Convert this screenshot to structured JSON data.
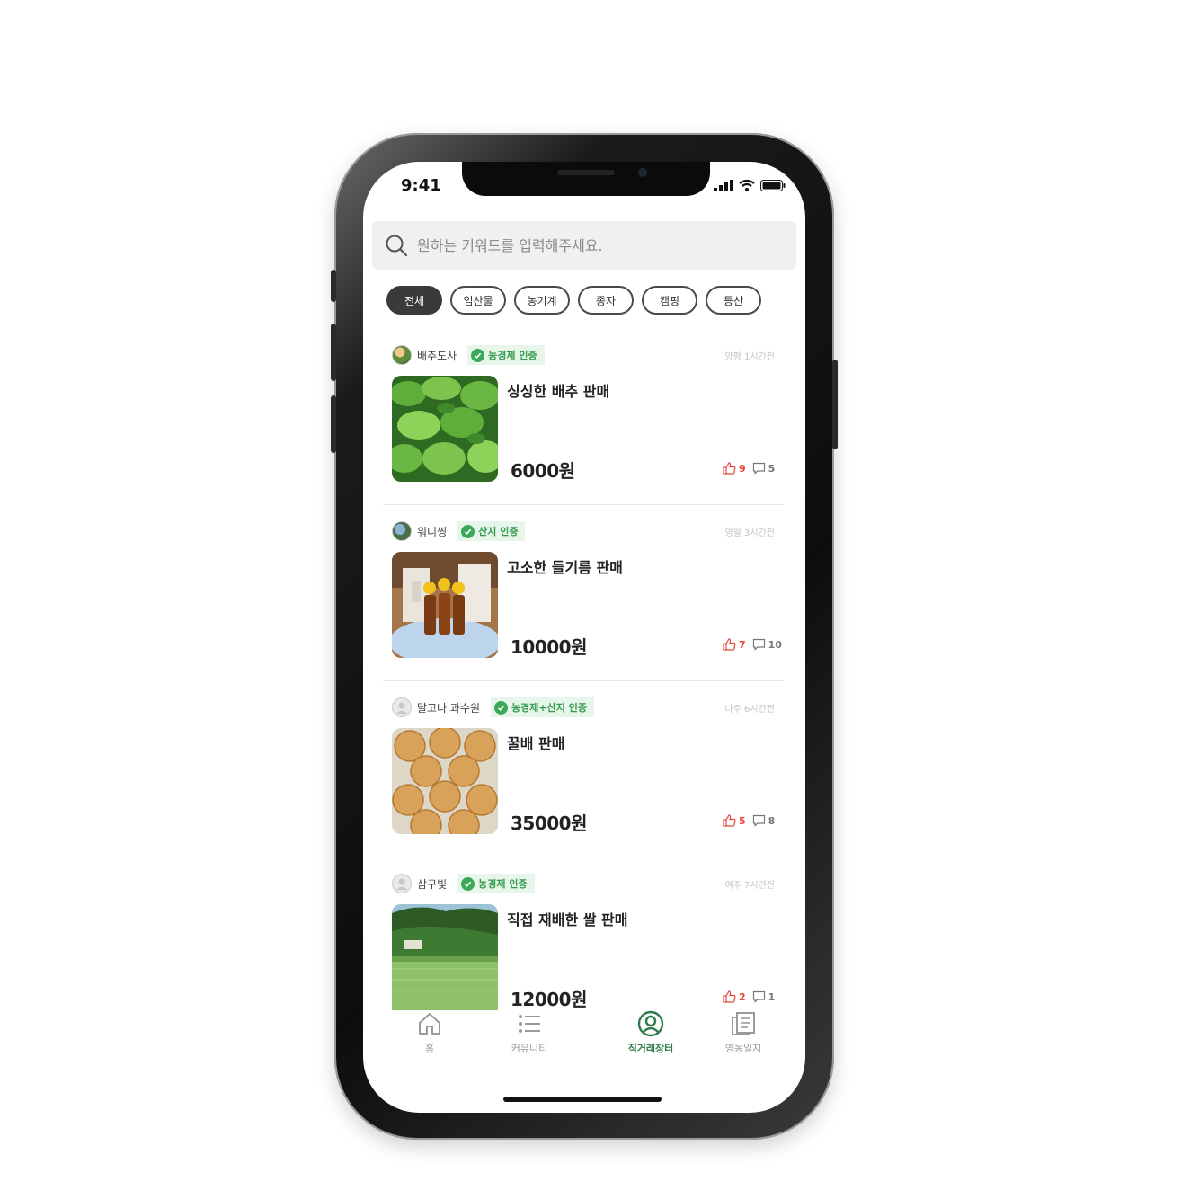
{
  "status_bar": {
    "time": "9:41"
  },
  "search": {
    "placeholder": "원하는 키워드를 입력해주세요."
  },
  "categories": [
    {
      "label": "전체",
      "active": true
    },
    {
      "label": "임산물",
      "active": false
    },
    {
      "label": "농기계",
      "active": false
    },
    {
      "label": "종자",
      "active": false
    },
    {
      "label": "캠핑",
      "active": false
    },
    {
      "label": "등산",
      "active": false
    }
  ],
  "posts": [
    {
      "seller": "배추도사",
      "certification": "농경제 인증",
      "posted": "양평 1시간전",
      "title": "싱싱한 배추 판매",
      "price": "6000원",
      "likes": "9",
      "comments": "5"
    },
    {
      "seller": "워니씽",
      "certification": "산지 인증",
      "posted": "영월 3시간전",
      "title": "고소한 들기름 판매",
      "price": "10000원",
      "likes": "7",
      "comments": "10"
    },
    {
      "seller": "달고나 과수원",
      "certification": "농경제+산지 인증",
      "posted": "나주 6시간전",
      "title": "꿀배 판매",
      "price": "35000원",
      "likes": "5",
      "comments": "8"
    },
    {
      "seller": "삼구빛",
      "certification": "농경제 인증",
      "posted": "여주 7시간전",
      "title": "직접 재배한 쌀 판매",
      "price": "12000원",
      "likes": "2",
      "comments": "1"
    }
  ],
  "tab_bar": [
    {
      "label": "홈",
      "icon": "home-icon",
      "active": false
    },
    {
      "label": "커뮤니티",
      "icon": "list-icon",
      "active": false
    },
    {
      "label": "직거래장터",
      "icon": "user-circle-icon",
      "active": true
    },
    {
      "label": "영농일지",
      "icon": "journal-icon",
      "active": false
    }
  ],
  "colors": {
    "certification_green": "#3aa957",
    "active_tab": "#2f7a4a",
    "like_red": "#e8453c"
  }
}
